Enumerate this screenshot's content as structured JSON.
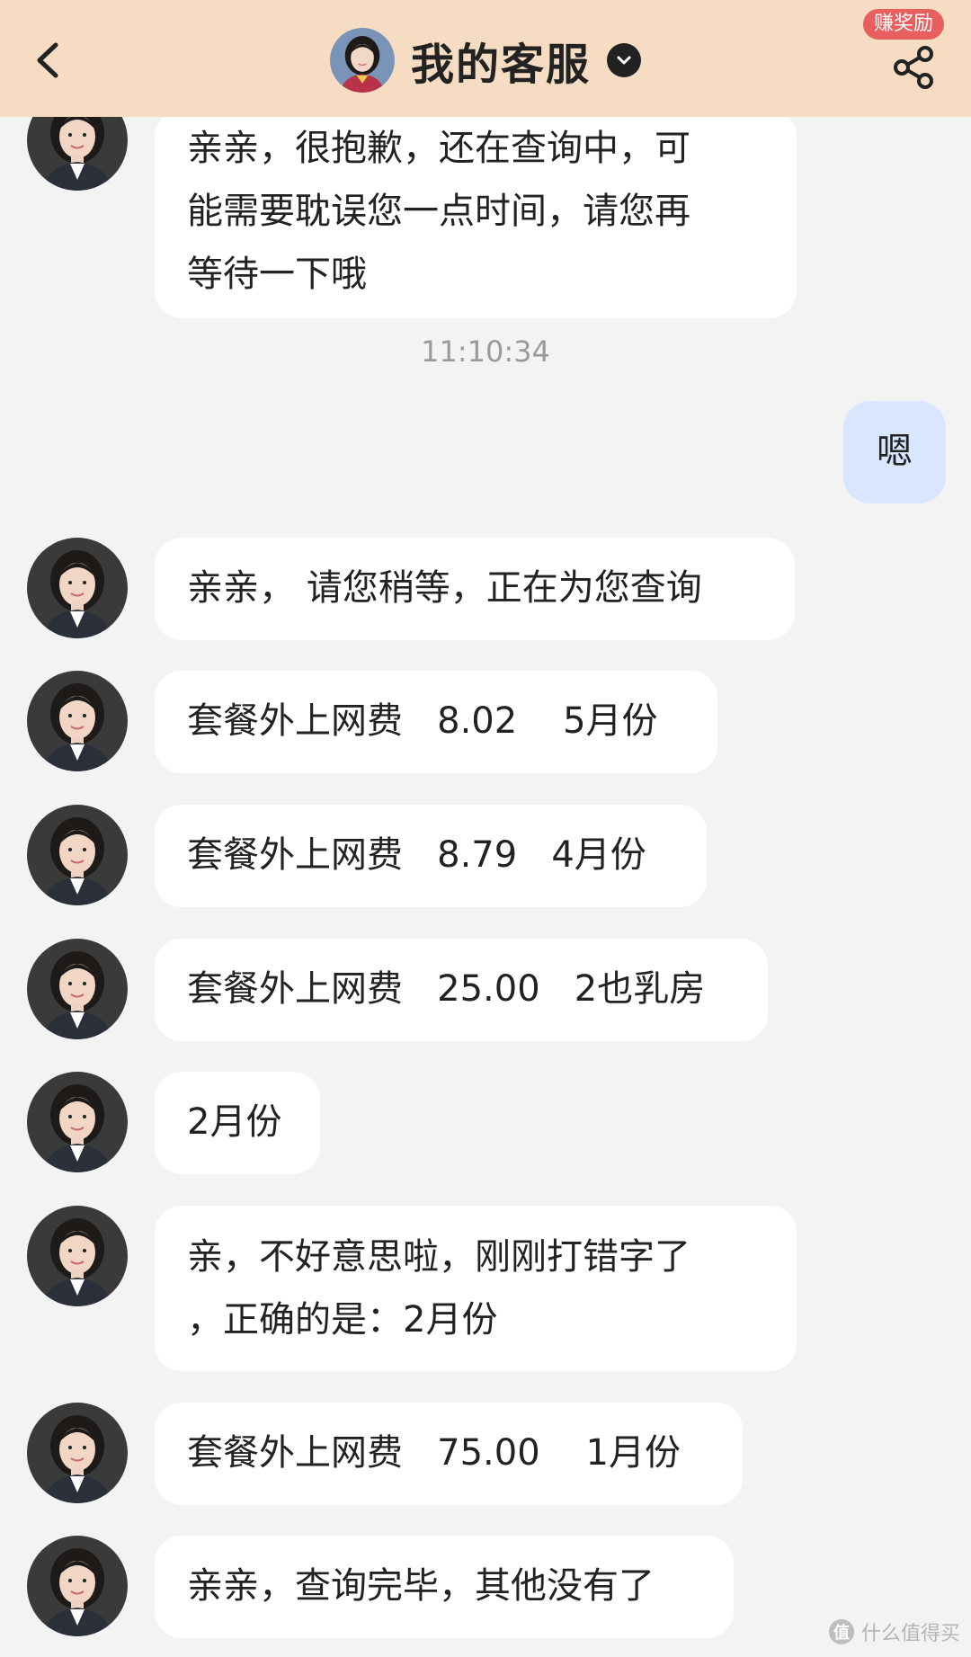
{
  "header": {
    "title": "我的客服",
    "reward_badge": "赚奖励",
    "back_icon": "chevron-left-icon",
    "share_icon": "share-icon",
    "verified_icon": "chevron-down-circle-icon",
    "background_color": "#f6dcc3"
  },
  "messages": [
    {
      "sender": "agent",
      "text": "亲亲，很抱歉，还在查询中，可\n能需要耽误您一点时间，请您再\n等待一下哦"
    },
    {
      "type": "timestamp",
      "text": "11:10:34"
    },
    {
      "sender": "user",
      "text": "嗯"
    },
    {
      "sender": "agent",
      "text": "亲亲， 请您稍等，正在为您查询"
    },
    {
      "sender": "agent",
      "text": "套餐外上网费   8.02    5月份"
    },
    {
      "sender": "agent",
      "text": "套餐外上网费   8.79   4月份"
    },
    {
      "sender": "agent",
      "text": "套餐外上网费   25.00   2也乳房"
    },
    {
      "sender": "agent",
      "text": "2月份"
    },
    {
      "sender": "agent",
      "text": "亲，不好意思啦，刚刚打错字了\n，正确的是：2月份"
    },
    {
      "sender": "agent",
      "text": "套餐外上网费   75.00    1月份"
    },
    {
      "sender": "agent",
      "text": "亲亲，查询完毕，其他没有了"
    }
  ],
  "watermark": {
    "icon_text": "值",
    "text": "什么值得买"
  },
  "colors": {
    "user_bubble": "#d9e6ff",
    "agent_bubble": "#ffffff",
    "chat_background": "#f3f3f3",
    "reward_badge": "#e85f5f"
  }
}
